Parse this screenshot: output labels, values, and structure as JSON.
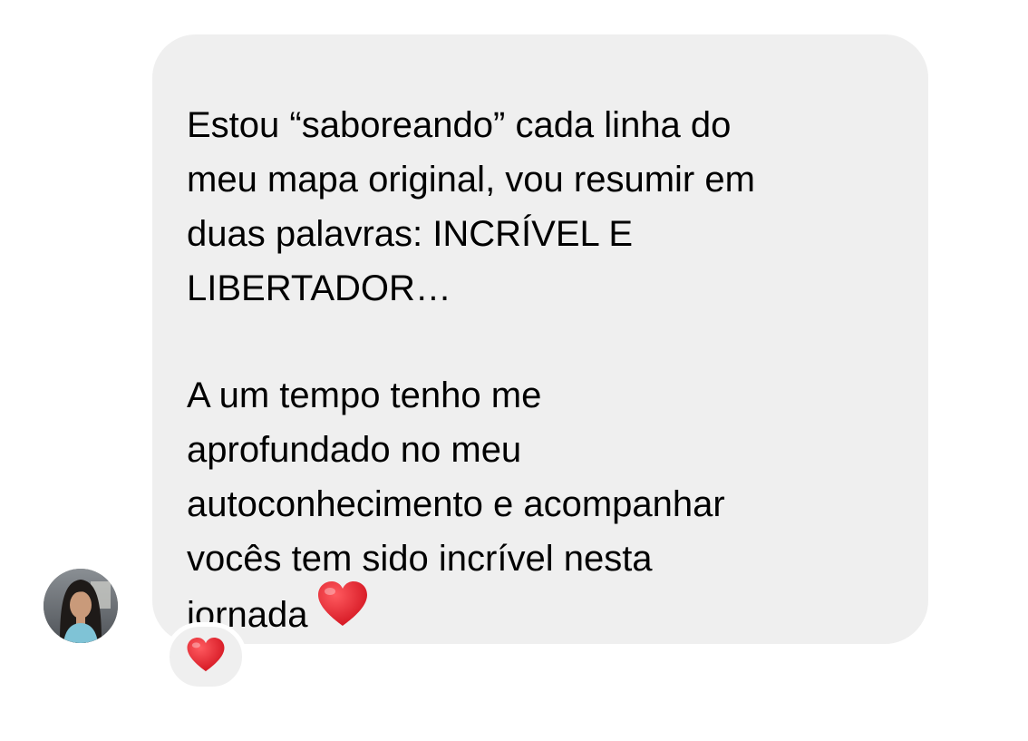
{
  "message": {
    "paragraph1": [
      "Estou “saboreando” cada linha do",
      "meu mapa original, vou resumir em",
      "duas palavras: INCRÍVEL E",
      "LIBERTADOR…"
    ],
    "paragraph2": [
      "A um tempo tenho me",
      "aprofundado no meu",
      "autoconhecimento e acompanhar",
      "vocês tem sido incrível nesta",
      "jornada"
    ],
    "trailing_emoji": "red-heart-icon",
    "bubble_color": "#efefef",
    "text_color": "#000000"
  },
  "sender": {
    "avatar": "user-avatar-photo"
  },
  "reaction": {
    "emoji": "red-heart-icon",
    "heart_color": "#e0202e"
  }
}
